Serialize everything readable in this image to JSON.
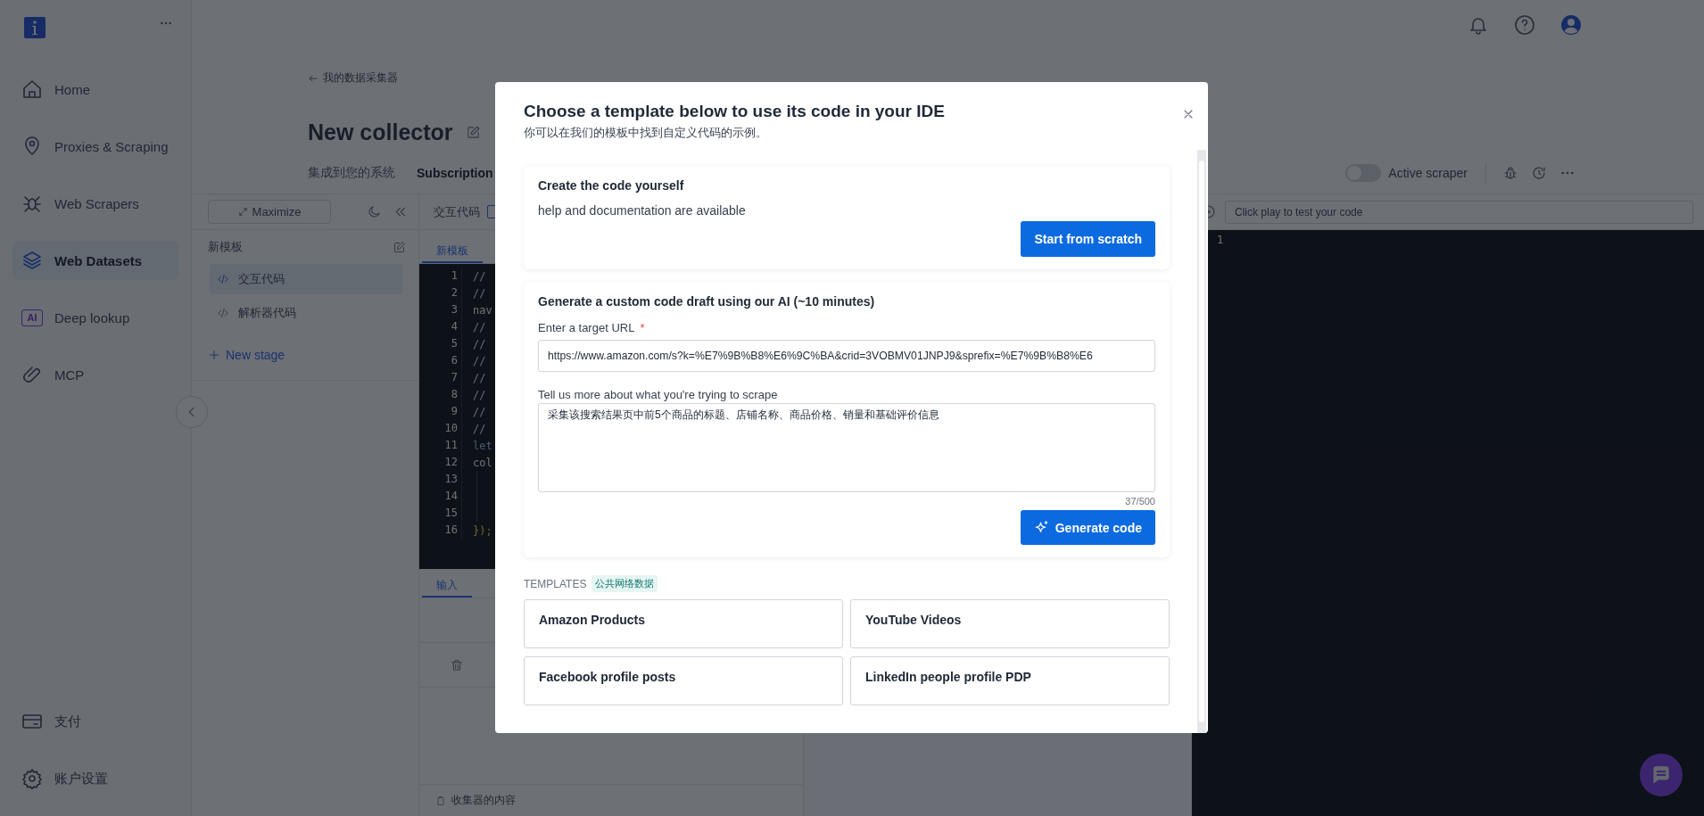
{
  "sidebar": {
    "items": [
      {
        "label": "Home",
        "kind": "home",
        "selected": false
      },
      {
        "label": "Proxies & Scraping",
        "kind": "pin",
        "selected": false
      },
      {
        "label": "Web Scrapers",
        "kind": "spider",
        "selected": false
      },
      {
        "label": "Web Datasets",
        "kind": "layers",
        "selected": true
      },
      {
        "label": "Deep lookup",
        "kind": "ai",
        "icon_text": "AI",
        "selected": false
      },
      {
        "label": "MCP",
        "kind": "clip",
        "selected": false
      }
    ],
    "bottom_items": [
      {
        "label": "支付",
        "kind": "card",
        "selected": false
      },
      {
        "label": "账户设置",
        "kind": "gear",
        "selected": false
      }
    ]
  },
  "header": {
    "breadcrumb": "我的数据采集器",
    "title": "New collector",
    "tabs": [
      {
        "label": "集成到您的系统",
        "selected": false
      },
      {
        "label": "Subscription",
        "selected": true
      }
    ],
    "active_scraper": {
      "label": "Active scraper",
      "on": false
    }
  },
  "stages_panel": {
    "maximize": "Maximize",
    "heading": "新模板",
    "stages": [
      {
        "label": "交互代码",
        "selected": true
      },
      {
        "label": "解析器代码",
        "selected": false
      }
    ],
    "new_stage": "New stage"
  },
  "editor": {
    "title": "交互代码",
    "tabs": [
      {
        "label": "新模板",
        "selected": true
      }
    ],
    "lines": [
      {
        "number": "1",
        "code": "//",
        "kind": "comment"
      },
      {
        "number": "2",
        "code": "//",
        "kind": "comment"
      },
      {
        "number": "3",
        "code": "nav",
        "kind": "plain"
      },
      {
        "number": "4",
        "code": "//",
        "kind": "comment"
      },
      {
        "number": "5",
        "code": "//",
        "kind": "comment"
      },
      {
        "number": "6",
        "code": "//",
        "kind": "comment"
      },
      {
        "number": "7",
        "code": "//",
        "kind": "comment"
      },
      {
        "number": "8",
        "code": "//",
        "kind": "comment"
      },
      {
        "number": "9",
        "code": "//",
        "kind": "comment"
      },
      {
        "number": "10",
        "code": "//",
        "kind": "comment"
      },
      {
        "number": "11",
        "code": "let",
        "kind": "keyword"
      },
      {
        "number": "12",
        "code": "col",
        "kind": "plain"
      },
      {
        "number": "13"
      },
      {
        "number": "14"
      },
      {
        "number": "15"
      },
      {
        "number": "16",
        "code": "});",
        "kind": "punct"
      }
    ]
  },
  "io_panel": {
    "tabs": [
      {
        "label": "输入",
        "selected": true
      }
    ],
    "footer": "收集器的内容"
  },
  "output": {
    "placeholder": "Click play to test your code",
    "line_numbers": [
      "1"
    ]
  },
  "modal": {
    "title": "Choose a template below to use its code in your IDE",
    "subtitle": "你可以在我们的模板中找到自定义代码的示例。",
    "scratch_card": {
      "title": "Create the code yourself",
      "text": "help and documentation are available",
      "button": "Start from scratch"
    },
    "ai_card": {
      "title": "Generate a custom code draft using our AI (~10 minutes)",
      "url_label": "Enter a target URL",
      "required_mark": "*",
      "url_value": "https://www.amazon.com/s?k=%E7%9B%B8%E6%9C%BA&crid=3VOBMV01JNPJ9&sprefix=%E7%9B%B8%E6",
      "details_label": "Tell us more about what you're trying to scrape",
      "details_value": "采集该搜索结果页中前5个商品的标题、店铺名称、商品价格、销量和基础评价信息",
      "count": "37/500",
      "button": "Generate code"
    },
    "templates_label": "TEMPLATES",
    "templates_tag": "公共网络数据",
    "templates": [
      "Amazon Products",
      "YouTube Videos",
      "Facebook profile posts",
      "LinkedIn people profile PDP"
    ]
  }
}
